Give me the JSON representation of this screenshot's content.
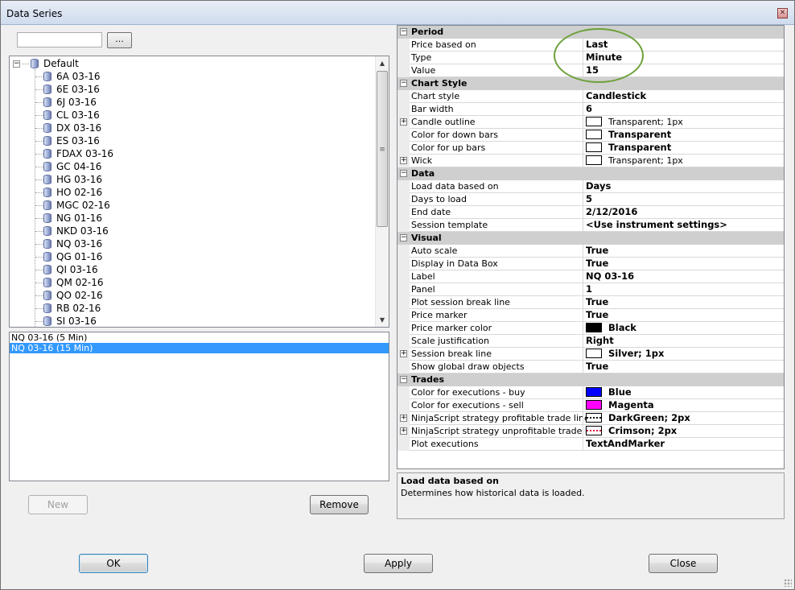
{
  "window": {
    "title": "Data Series",
    "close_icon": "close-icon"
  },
  "search": {
    "value": "",
    "button_label": "..."
  },
  "tree": {
    "root": "Default",
    "items": [
      "6A 03-16",
      "6E 03-16",
      "6J 03-16",
      "CL 03-16",
      "DX 03-16",
      "ES 03-16",
      "FDAX 03-16",
      "GC 04-16",
      "HG 03-16",
      "HO 02-16",
      "MGC 02-16",
      "NG 01-16",
      "NKD 03-16",
      "NQ 03-16",
      "QG 01-16",
      "QI 03-16",
      "QM 02-16",
      "QO 02-16",
      "RB 02-16",
      "SI 03-16"
    ]
  },
  "series_list": [
    {
      "label": "NQ 03-16 (5 Min)",
      "selected": false
    },
    {
      "label": "NQ 03-16 (15 Min)",
      "selected": true
    }
  ],
  "buttons": {
    "new": "New",
    "remove": "Remove",
    "ok": "OK",
    "apply": "Apply",
    "close": "Close"
  },
  "properties": [
    {
      "category": "Period",
      "rows": [
        {
          "label": "Price based on",
          "value": "Last"
        },
        {
          "label": "Type",
          "value": "Minute"
        },
        {
          "label": "Value",
          "value": "15"
        }
      ]
    },
    {
      "category": "Chart Style",
      "rows": [
        {
          "label": "Chart style",
          "value": "Candlestick"
        },
        {
          "label": "Bar width",
          "value": "6"
        },
        {
          "label": "Candle outline",
          "value": "Transparent; 1px",
          "expandable": true,
          "swatch": "#ffffff",
          "plain": true
        },
        {
          "label": "Color for down bars",
          "value": "Transparent",
          "swatch": "#ffffff"
        },
        {
          "label": "Color for up bars",
          "value": "Transparent",
          "swatch": "#ffffff"
        },
        {
          "label": "Wick",
          "value": "Transparent; 1px",
          "expandable": true,
          "swatch": "#ffffff",
          "plain": true
        }
      ]
    },
    {
      "category": "Data",
      "rows": [
        {
          "label": "Load data based on",
          "value": "Days"
        },
        {
          "label": "Days to load",
          "value": "5"
        },
        {
          "label": "End date",
          "value": "2/12/2016"
        },
        {
          "label": "Session template",
          "value": "<Use instrument settings>"
        }
      ]
    },
    {
      "category": "Visual",
      "rows": [
        {
          "label": "Auto scale",
          "value": "True"
        },
        {
          "label": "Display in Data Box",
          "value": "True"
        },
        {
          "label": "Label",
          "value": "NQ 03-16"
        },
        {
          "label": "Panel",
          "value": "1"
        },
        {
          "label": "Plot session break line",
          "value": "True"
        },
        {
          "label": "Price marker",
          "value": "True"
        },
        {
          "label": "Price marker color",
          "value": "Black",
          "swatch": "#000000"
        },
        {
          "label": "Scale justification",
          "value": "Right"
        },
        {
          "label": "Session break line",
          "value": "Silver; 1px",
          "expandable": true,
          "swatch": "#ffffff"
        },
        {
          "label": "Show global draw objects",
          "value": "True"
        }
      ]
    },
    {
      "category": "Trades",
      "rows": [
        {
          "label": "Color for executions - buy",
          "value": "Blue",
          "swatch": "#0000ff"
        },
        {
          "label": "Color for executions - sell",
          "value": "Magenta",
          "swatch": "#ff00ff"
        },
        {
          "label": "NinjaScript strategy profitable trade line",
          "value": "DarkGreen; 2px",
          "expandable": true,
          "swatch": "dots-dark"
        },
        {
          "label": "NinjaScript strategy unprofitable trade line",
          "value": "Crimson; 2px",
          "expandable": true,
          "swatch": "dots-red"
        },
        {
          "label": "Plot executions",
          "value": "TextAndMarker"
        }
      ]
    }
  ],
  "description": {
    "title": "Load data based on",
    "text": "Determines how historical data is loaded."
  }
}
